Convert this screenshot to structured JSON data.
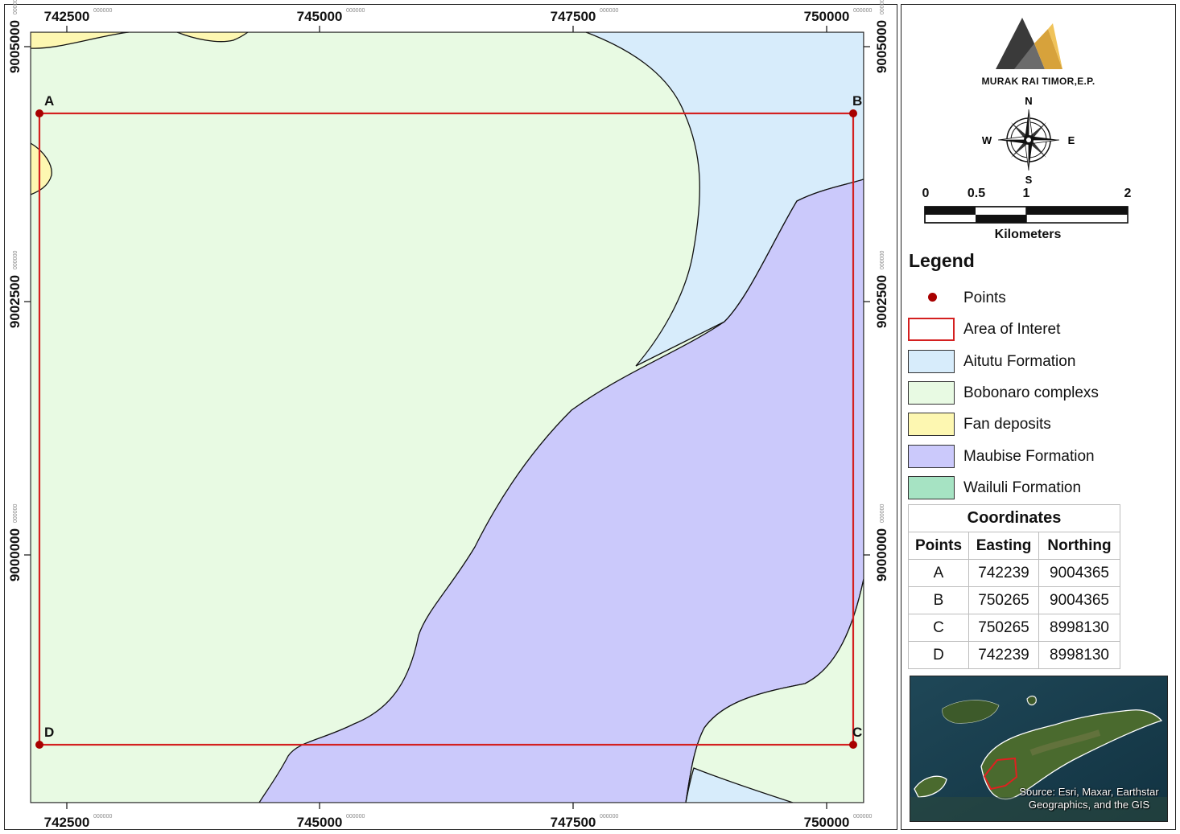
{
  "axes": {
    "x_ticks": [
      "742500",
      "745000",
      "747500",
      "750000"
    ],
    "y_ticks": [
      "9005000",
      "9002500",
      "9000000"
    ],
    "tick_suffix": "000000"
  },
  "points": [
    {
      "name": "A",
      "easting": "742239",
      "northing": "9004365"
    },
    {
      "name": "B",
      "easting": "750265",
      "northing": "9004365"
    },
    {
      "name": "C",
      "easting": "750265",
      "northing": "8998130"
    },
    {
      "name": "D",
      "easting": "742239",
      "northing": "8998130"
    }
  ],
  "colors": {
    "aitutu": "#d7ecfb",
    "bobonaro": "#e8fae3",
    "fan": "#fdf7b1",
    "maubise": "#cbc9fb",
    "wailuli": "#a6e3c3",
    "area_outline": "#d42020",
    "point": "#a80000"
  },
  "logo": {
    "company": "MURAK RAI TIMOR,E.P."
  },
  "north_arrow": {
    "n": "N",
    "s": "S",
    "e": "E",
    "w": "W"
  },
  "scale_bar": {
    "labels": [
      "0",
      "0.5",
      "1",
      "2"
    ],
    "unit": "Kilometers"
  },
  "legend": {
    "title": "Legend",
    "items": [
      {
        "label": "Points",
        "kind": "point"
      },
      {
        "label": "Area of Interet",
        "kind": "outline"
      },
      {
        "label": "Aitutu Formation",
        "kind": "fill",
        "color": "#d7ecfb"
      },
      {
        "label": "Bobonaro complexs",
        "kind": "fill",
        "color": "#e8fae3"
      },
      {
        "label": "Fan deposits",
        "kind": "fill",
        "color": "#fdf7b1"
      },
      {
        "label": "Maubise Formation",
        "kind": "fill",
        "color": "#cbc9fb"
      },
      {
        "label": "Wailuli Formation",
        "kind": "fill",
        "color": "#a6e3c3"
      }
    ]
  },
  "coordinates_table": {
    "title": "Coordinates",
    "headers": [
      "Points",
      "Easting",
      "Northing"
    ]
  },
  "inset": {
    "credit": "Source: Esri, Maxar, Earthstar Geographics, and the GIS"
  }
}
